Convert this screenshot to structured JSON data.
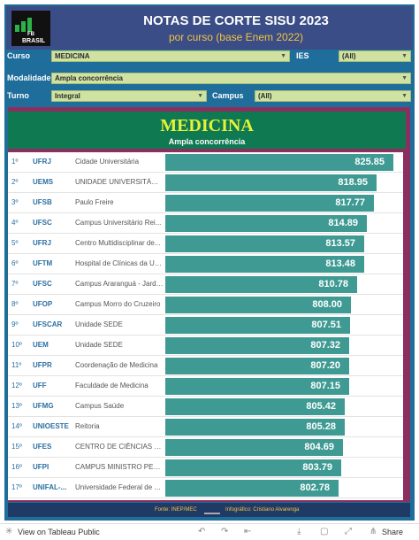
{
  "header": {
    "logo_top": "FB",
    "logo_bottom": "BRASIL",
    "title": "NOTAS DE CORTE SISU 2023",
    "subtitle": "por curso (base Enem 2022)"
  },
  "filters": {
    "curso_label": "Curso",
    "curso_value": "MEDICINA",
    "ies_label": "IES",
    "ies_value": "(All)",
    "modalidade_label": "Modalidade",
    "modalidade_value": "Ampla concorrência",
    "turno_label": "Turno",
    "turno_value": "Integral",
    "campus_label": "Campus",
    "campus_value": "(All)"
  },
  "panel": {
    "course": "MEDICINA",
    "modality": "Ampla concorrência"
  },
  "rows": [
    {
      "rank": "1º",
      "uni": "UFRJ",
      "campus": "Cidade Universitária",
      "score": "825.85",
      "value": 825.85
    },
    {
      "rank": "2º",
      "uni": "UEMS",
      "campus": "UNIDADE UNIVERSITÁRIA...",
      "score": "818.95",
      "value": 818.95
    },
    {
      "rank": "3º",
      "uni": "UFSB",
      "campus": "Paulo Freire",
      "score": "817.77",
      "value": 817.77
    },
    {
      "rank": "4º",
      "uni": "UFSC",
      "campus": "Campus Universitário Rei...",
      "score": "814.89",
      "value": 814.89
    },
    {
      "rank": "5º",
      "uni": "UFRJ",
      "campus": "Centro Multidisciplinar de...",
      "score": "813.57",
      "value": 813.57
    },
    {
      "rank": "6º",
      "uni": "UFTM",
      "campus": "Hospital de Clínicas da UF...",
      "score": "813.48",
      "value": 813.48
    },
    {
      "rank": "7º",
      "uni": "UFSC",
      "campus": "Campus Araranguá - Jardi...",
      "score": "810.78",
      "value": 810.78
    },
    {
      "rank": "8º",
      "uni": "UFOP",
      "campus": "Campus Morro do Cruzeiro",
      "score": "808.00",
      "value": 808.0
    },
    {
      "rank": "9º",
      "uni": "UFSCAR",
      "campus": "Unidade SEDE",
      "score": "807.51",
      "value": 807.51
    },
    {
      "rank": "10º",
      "uni": "UEM",
      "campus": "Unidade SEDE",
      "score": "807.32",
      "value": 807.32
    },
    {
      "rank": "11º",
      "uni": "UFPR",
      "campus": "Coordenação de Medicina",
      "score": "807.20",
      "value": 807.2
    },
    {
      "rank": "12º",
      "uni": "UFF",
      "campus": "Faculdade de Medicina",
      "score": "807.15",
      "value": 807.15
    },
    {
      "rank": "13º",
      "uni": "UFMG",
      "campus": "Campus Saúde",
      "score": "805.42",
      "value": 805.42
    },
    {
      "rank": "14º",
      "uni": "UNIOESTE",
      "campus": "Reitoria",
      "score": "805.28",
      "value": 805.28
    },
    {
      "rank": "15º",
      "uni": "UFES",
      "campus": "CENTRO DE CIÊNCIAS DA ...",
      "score": "804.69",
      "value": 804.69
    },
    {
      "rank": "16º",
      "uni": "UFPI",
      "campus": "CAMPUS MINISTRO PETR...",
      "score": "803.79",
      "value": 803.79
    },
    {
      "rank": "17º",
      "uni": "UNIFAL-...",
      "campus": "Universidade Federal de A...",
      "score": "802.78",
      "value": 802.78
    }
  ],
  "footer": {
    "source": "Fonte: INEP/MEC",
    "credit": "Infográfico: Cristiano Alvarenga"
  },
  "bottombar": {
    "view_label": "View on Tableau Public",
    "share_label": "Share"
  },
  "colors": {
    "frame": "#1e6d9b",
    "header": "#3a4d86",
    "bar": "#3f9a93",
    "title_green": "#0f7a51",
    "accent_yellow": "#e7f238",
    "panel_border": "#8b2f5e"
  }
}
